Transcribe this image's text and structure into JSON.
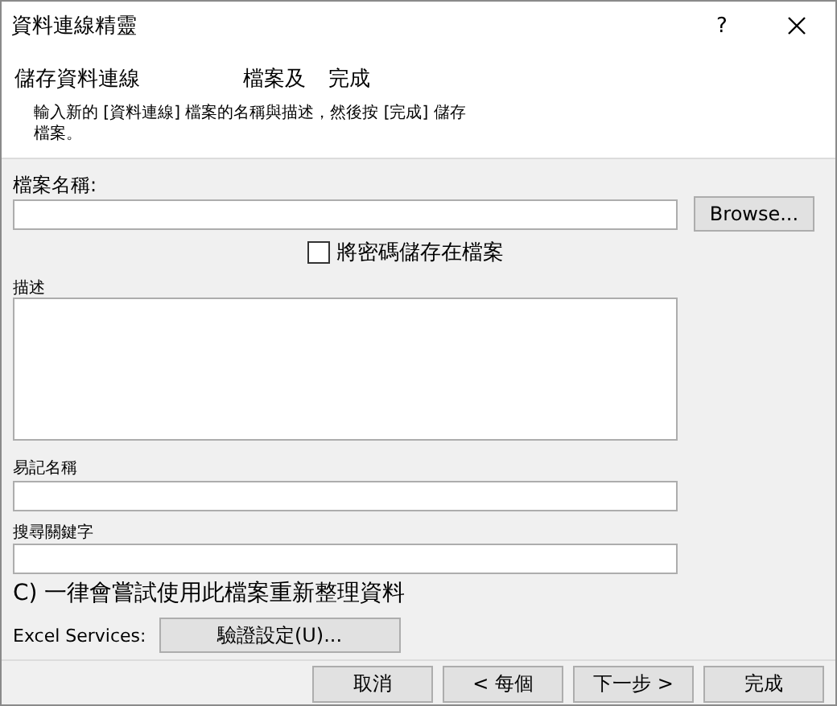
{
  "window": {
    "title": "資料連線精靈",
    "help": "?"
  },
  "header": {
    "heading_parts": [
      "儲存資料連線",
      "檔案及",
      "完成"
    ],
    "description": "輸入新的 [資料連線] 檔案的名稱與描述，然後按 [完成] 儲存檔案。"
  },
  "file_name": {
    "label": "檔案名稱:",
    "browse": "Browse..."
  },
  "save_password": {
    "label": "將密碼儲存在檔案",
    "checked": false
  },
  "fields": [
    {
      "label": "描述",
      "kind": "multiline"
    },
    {
      "label": "易記名稱",
      "kind": "line"
    },
    {
      "label": "搜尋關鍵字",
      "kind": "line"
    }
  ],
  "refresh_option": "C) 一律會嘗試使用此檔案重新整理資料",
  "excel_services": {
    "label": "Excel Services:",
    "button": "驗證設定(U)..."
  },
  "buttons": [
    "取消",
    "< 每個",
    "下一步 >",
    "完成"
  ]
}
